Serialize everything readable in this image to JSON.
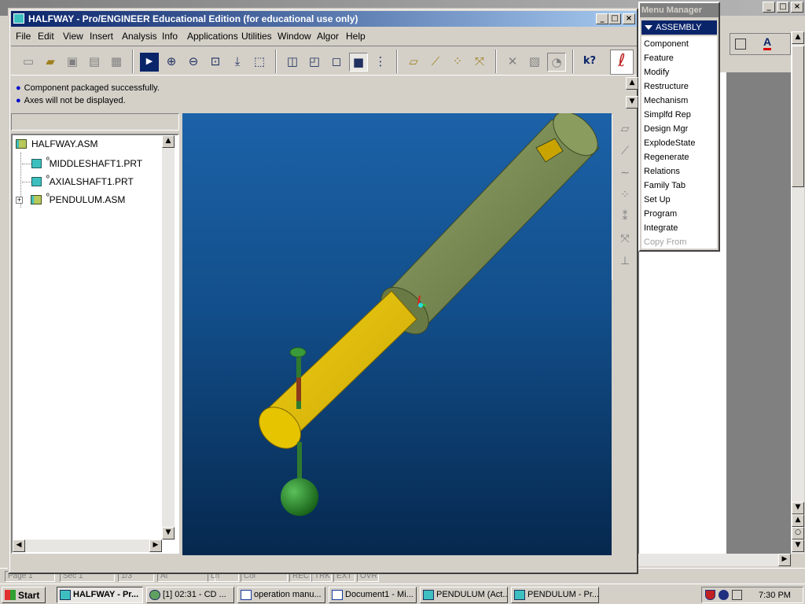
{
  "window": {
    "title": "HALFWAY - Pro/ENGINEER Educational Edition (for educational use only)"
  },
  "menu": [
    "File",
    "Edit",
    "View",
    "Insert",
    "Analysis",
    "Info",
    "Applications",
    "Utilities",
    "Window",
    "Algor",
    "Help"
  ],
  "messages": [
    "Component packaged successfully.",
    "Axes will not be displayed."
  ],
  "model_tree": {
    "root": "HALFWAY.ASM",
    "items": [
      "MIDDLESHAFT1.PRT",
      "AXIALSHAFT1.PRT",
      "PENDULUM.ASM"
    ],
    "item_flags": [
      "º",
      "º",
      "º"
    ]
  },
  "menu_manager": {
    "title": "Menu Manager",
    "header": "ASSEMBLY",
    "items": [
      "Component",
      "Feature",
      "Modify",
      "Restructure",
      "Mechanism",
      "Simplfd Rep",
      "Design Mgr",
      "ExplodeState",
      "Regenerate",
      "Relations",
      "Family Tab",
      "Set Up",
      "Program",
      "Integrate",
      "Copy From"
    ]
  },
  "status": {
    "page": "Page 1",
    "sec": "Sec 1",
    "pages": "1/3",
    "at": "At",
    "ln": "Ln",
    "col": "Col",
    "rec": "REC",
    "trk": "TRK",
    "ext": "EXT",
    "ovr": "OVR"
  },
  "taskbar": {
    "start": "Start",
    "buttons": [
      "HALFWAY - Pr...",
      "[1] 02:31 - CD ...",
      "operation manu...",
      "Document1 - Mi...",
      "PENDULUM (Act...",
      "PENDULUM - Pr..."
    ],
    "clock": "7:30 PM"
  },
  "colors": {
    "title_active": "#0a246a",
    "viewport_top": "#1c62a8",
    "viewport_bottom": "#06284e",
    "outer_shaft": "#7a8c52",
    "inner_shaft": "#e6c200",
    "pendulum": "#2f8a2f"
  },
  "icons": {
    "word_font_color": "A",
    "help_cursor": "k?"
  }
}
